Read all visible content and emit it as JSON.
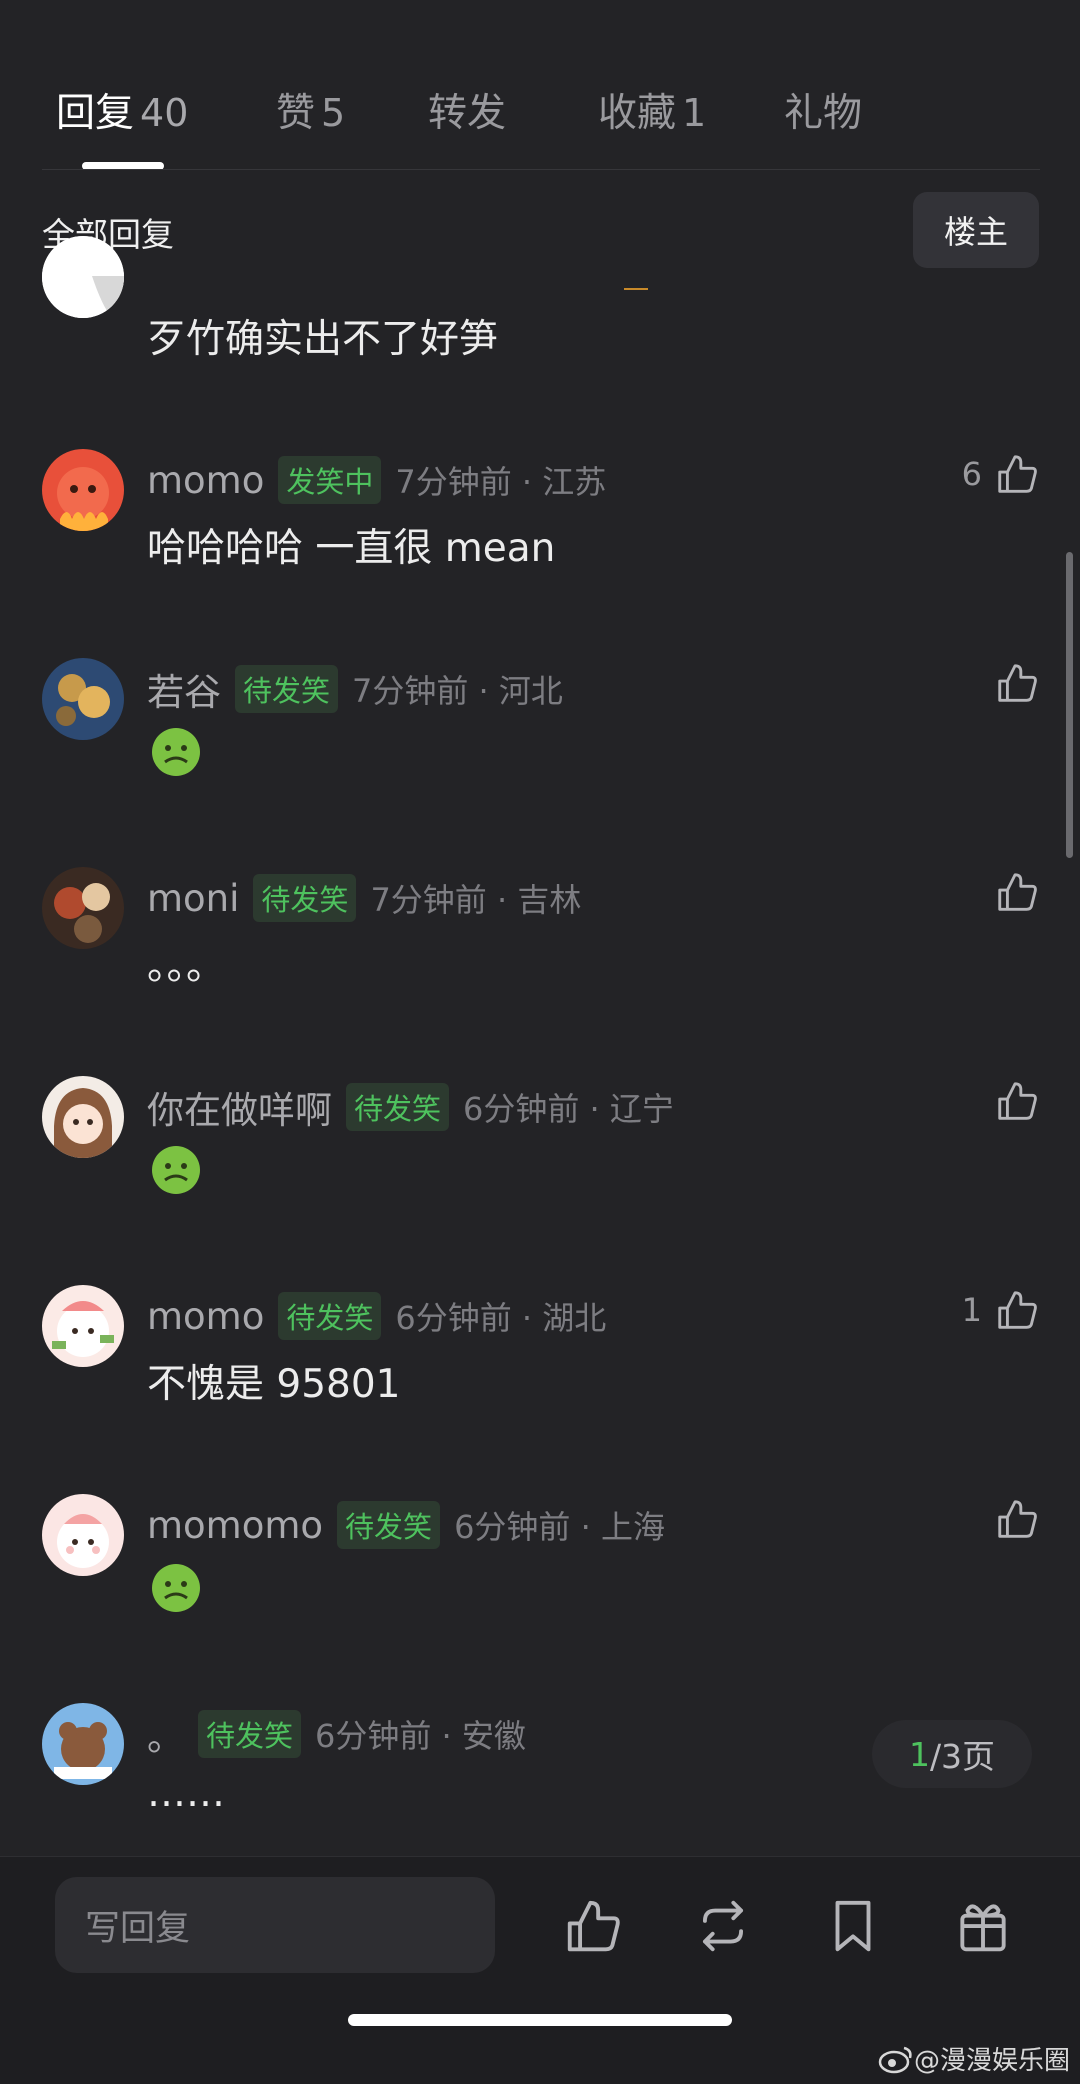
{
  "tabs": [
    {
      "label": "回复",
      "count": "40"
    },
    {
      "label": "赞",
      "count": "5"
    },
    {
      "label": "转发",
      "count": ""
    },
    {
      "label": "收藏",
      "count": "1"
    },
    {
      "label": "礼物",
      "count": ""
    }
  ],
  "section": {
    "title": "全部回复",
    "owner_button": "楼主"
  },
  "partial_comment": {
    "text": "歹竹确实出不了好笋"
  },
  "comments": [
    {
      "username": "momo",
      "badge": "发笑中",
      "time": "7分钟前 · 江苏",
      "text": "哈哈哈哈 一直很 mean",
      "likes": "6",
      "emoji": ""
    },
    {
      "username": "若谷",
      "badge": "待发笑",
      "time": "7分钟前 · 河北",
      "text": "",
      "likes": "",
      "emoji": "nauseated-face"
    },
    {
      "username": "moni",
      "badge": "待发笑",
      "time": "7分钟前 · 吉林",
      "text": "。。。",
      "likes": "",
      "emoji": ""
    },
    {
      "username": "你在做咩啊",
      "badge": "待发笑",
      "time": "6分钟前 · 辽宁",
      "text": "",
      "likes": "",
      "emoji": "nauseated-face"
    },
    {
      "username": "momo",
      "badge": "待发笑",
      "time": "6分钟前 · 湖北",
      "text": "不愧是 95801",
      "likes": "1",
      "emoji": ""
    },
    {
      "username": "momomo",
      "badge": "待发笑",
      "time": "6分钟前 · 上海",
      "text": "",
      "likes": "",
      "emoji": "nauseated-face"
    },
    {
      "username": "。",
      "badge": "待发笑",
      "time": "6分钟前 · 安徽",
      "text": "……",
      "likes": "",
      "emoji": ""
    }
  ],
  "pager": {
    "current": "1",
    "rest": "/3页"
  },
  "bottom": {
    "reply_placeholder": "写回复"
  },
  "watermark": "@漫漫娱乐圈",
  "colors": {
    "background": "#232326",
    "badge_green": "#4ec25e",
    "text": "#ececec",
    "muted": "#7d7d82"
  }
}
